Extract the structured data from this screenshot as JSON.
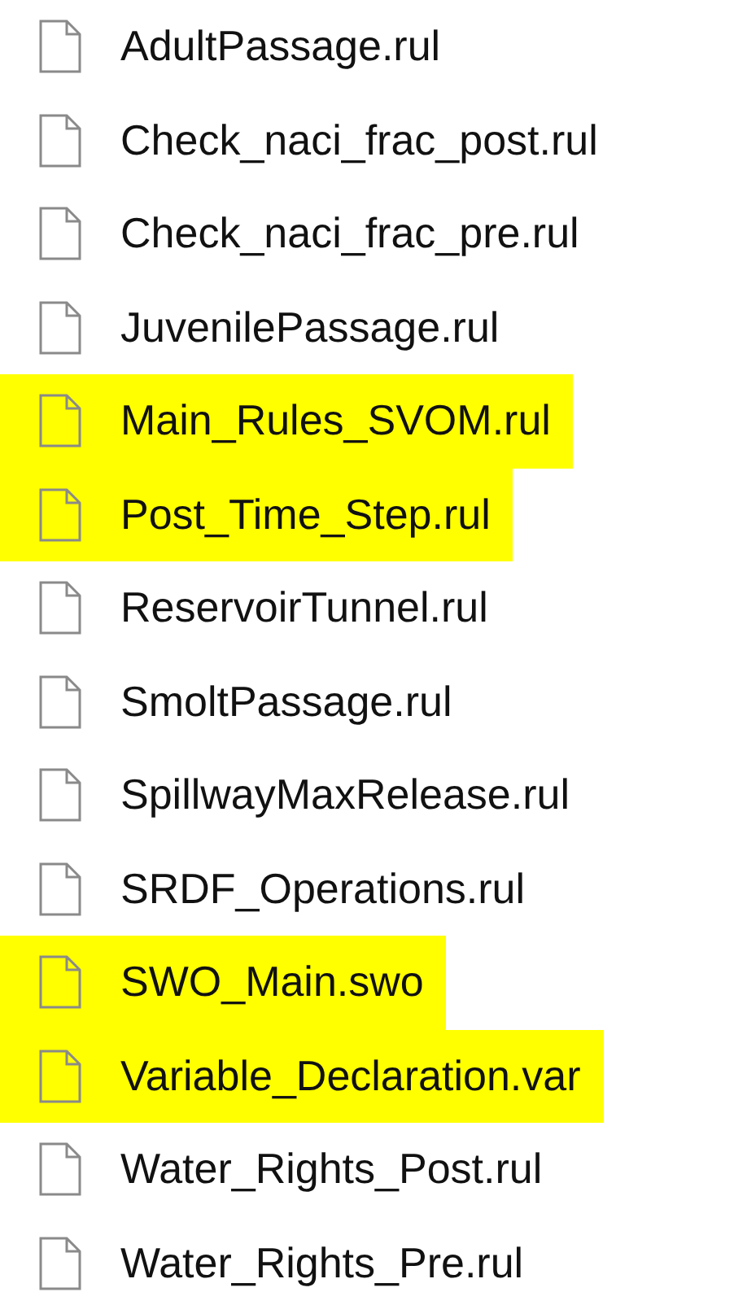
{
  "files": [
    {
      "name": "AdultPassage.rul",
      "highlighted": false
    },
    {
      "name": "Check_naci_frac_post.rul",
      "highlighted": false
    },
    {
      "name": "Check_naci_frac_pre.rul",
      "highlighted": false
    },
    {
      "name": "JuvenilePassage.rul",
      "highlighted": false
    },
    {
      "name": "Main_Rules_SVOM.rul",
      "highlighted": true
    },
    {
      "name": "Post_Time_Step.rul",
      "highlighted": true
    },
    {
      "name": "ReservoirTunnel.rul",
      "highlighted": false
    },
    {
      "name": "SmoltPassage.rul",
      "highlighted": false
    },
    {
      "name": "SpillwayMaxRelease.rul",
      "highlighted": false
    },
    {
      "name": "SRDF_Operations.rul",
      "highlighted": false
    },
    {
      "name": "SWO_Main.swo",
      "highlighted": true
    },
    {
      "name": "Variable_Declaration.var",
      "highlighted": true
    },
    {
      "name": "Water_Rights_Post.rul",
      "highlighted": false
    },
    {
      "name": "Water_Rights_Pre.rul",
      "highlighted": false
    }
  ]
}
